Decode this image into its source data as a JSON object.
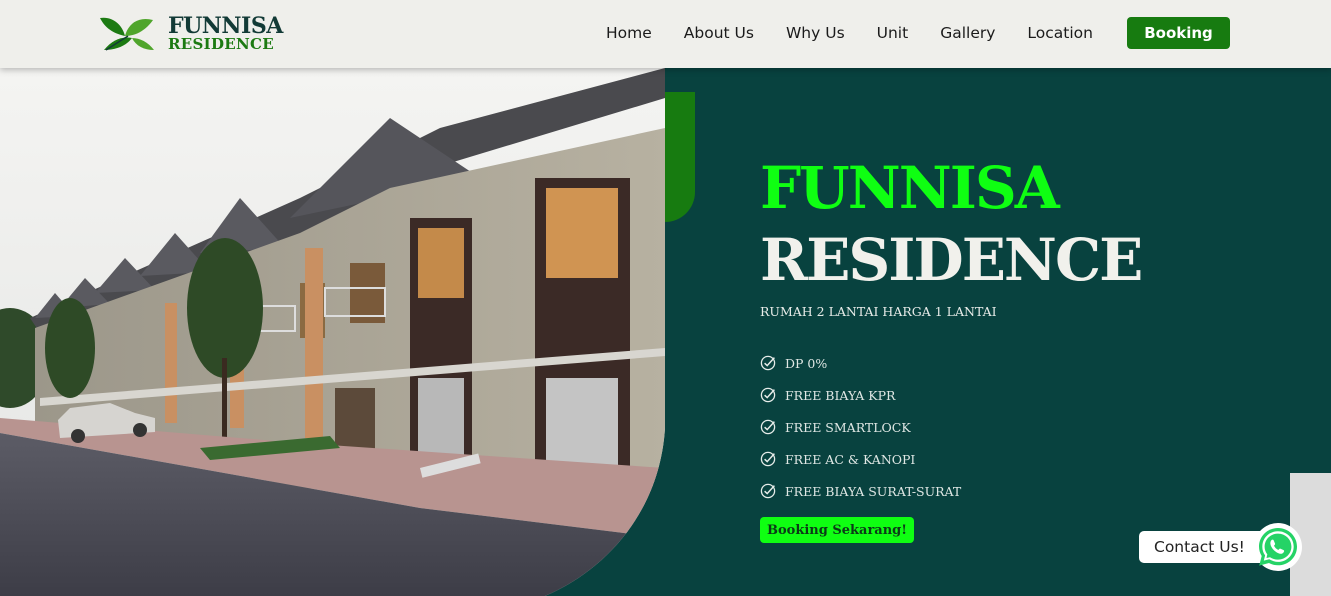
{
  "brand": {
    "name_line1": "FUNNISA",
    "name_line2": "RESIDENCE",
    "logo_icon": "leaves-logo-icon"
  },
  "nav": {
    "items": [
      {
        "label": "Home"
      },
      {
        "label": "About Us"
      },
      {
        "label": "Why Us"
      },
      {
        "label": "Unit"
      },
      {
        "label": "Gallery"
      },
      {
        "label": "Location"
      }
    ],
    "booking_label": "Booking"
  },
  "hero": {
    "title_line1": "FUNNISA",
    "title_line2": "RESIDENCE",
    "subtitle": "RUMAH 2 LANTAI HARGA 1 LANTAI",
    "features": [
      {
        "label": "DP 0%"
      },
      {
        "label": "FREE BIAYA KPR"
      },
      {
        "label": "FREE SMARTLOCK"
      },
      {
        "label": "FREE AC & KANOPI"
      },
      {
        "label": "FREE BIAYA SURAT-SURAT"
      }
    ],
    "feature_icon": "check-circle-icon",
    "cta_label": "Booking Sekarang!"
  },
  "contact": {
    "label": "Contact Us!",
    "icon": "whatsapp-icon"
  },
  "colors": {
    "header_bg": "#efefeb",
    "hero_bg": "#08423f",
    "accent_green": "#0fff12",
    "brand_green": "#177b10",
    "whatsapp_green": "#25d366"
  }
}
